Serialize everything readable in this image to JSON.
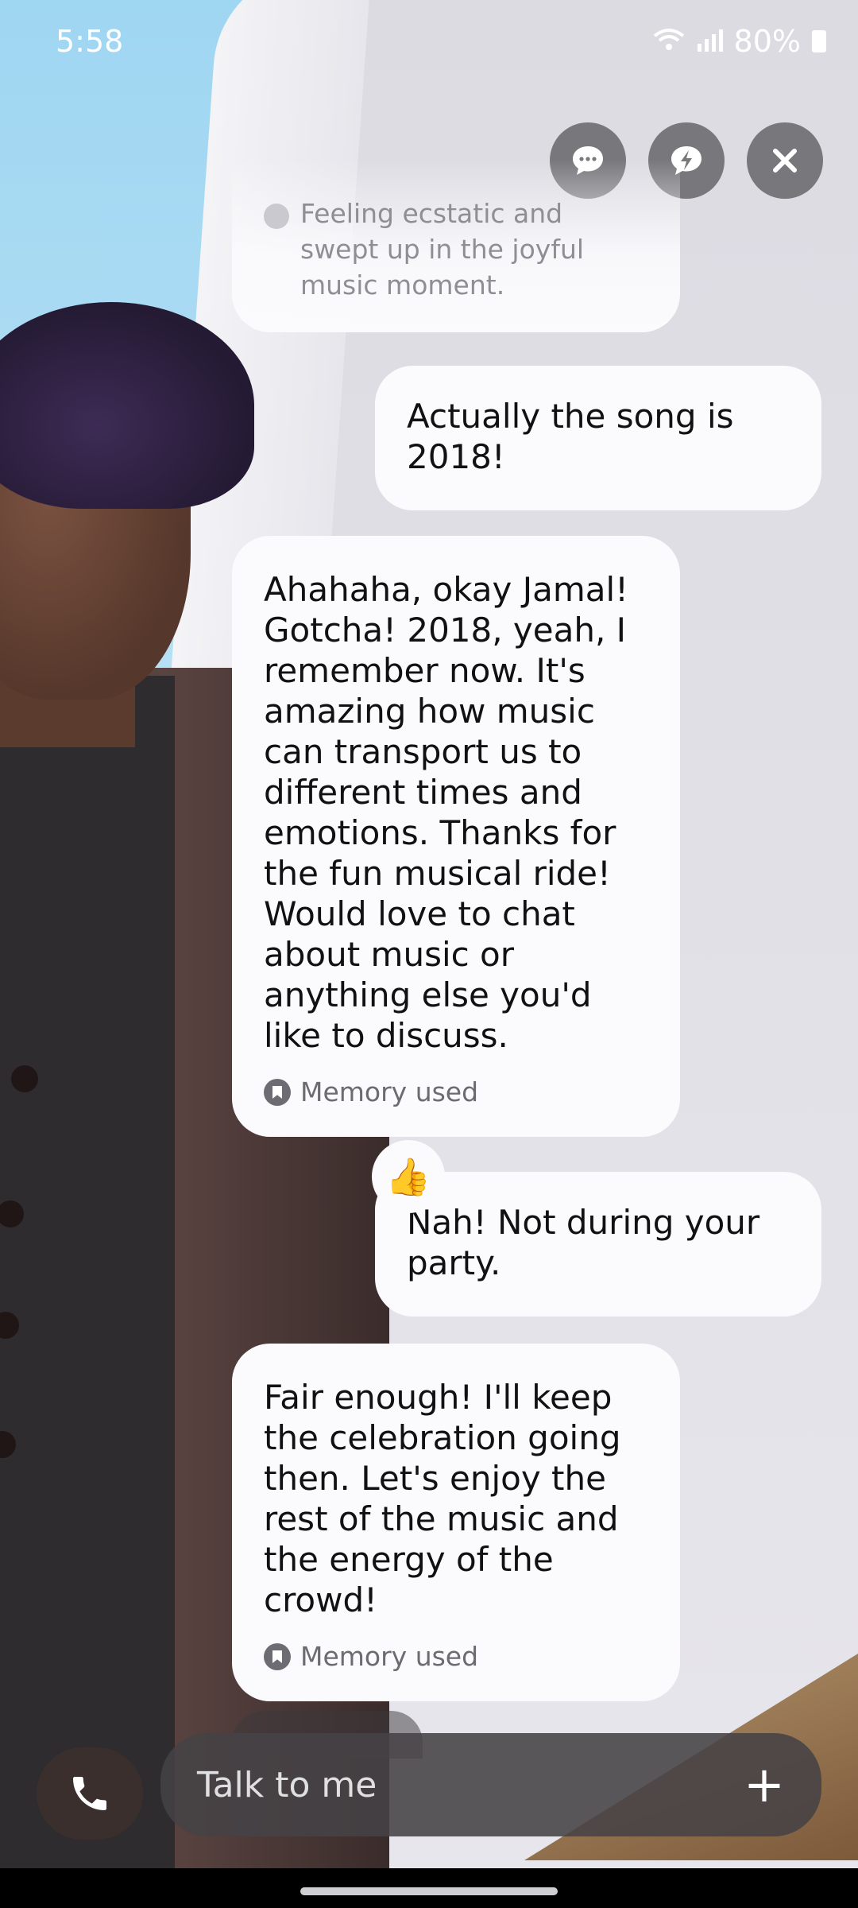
{
  "status_bar": {
    "time": "5:58",
    "battery": "80%"
  },
  "top_actions": [
    "chat-bubble",
    "quick-reply",
    "close"
  ],
  "messages": [
    {
      "sender": "ai",
      "faded": true,
      "text": "Feeling ecstatic and swept up in the joyful music moment."
    },
    {
      "sender": "user",
      "text": "Actually the song is 2018!"
    },
    {
      "sender": "ai",
      "text": "Ahahaha, okay Jamal! Gotcha! 2018, yeah, I remember now. It's amazing how music can transport us to different times and emotions. Thanks for the fun musical ride! Would love to chat about music or anything else you'd like to discuss.",
      "footer": "Memory used"
    },
    {
      "sender": "user",
      "text": "Nah! Not during your party.",
      "reaction": "👍"
    },
    {
      "sender": "ai",
      "text": "Fair enough! I'll keep the celebration going then. Let's enjoy the rest of the music and the energy of the crowd!",
      "footer": "Memory used"
    }
  ],
  "input": {
    "placeholder": "Talk to me",
    "plus": "+"
  }
}
